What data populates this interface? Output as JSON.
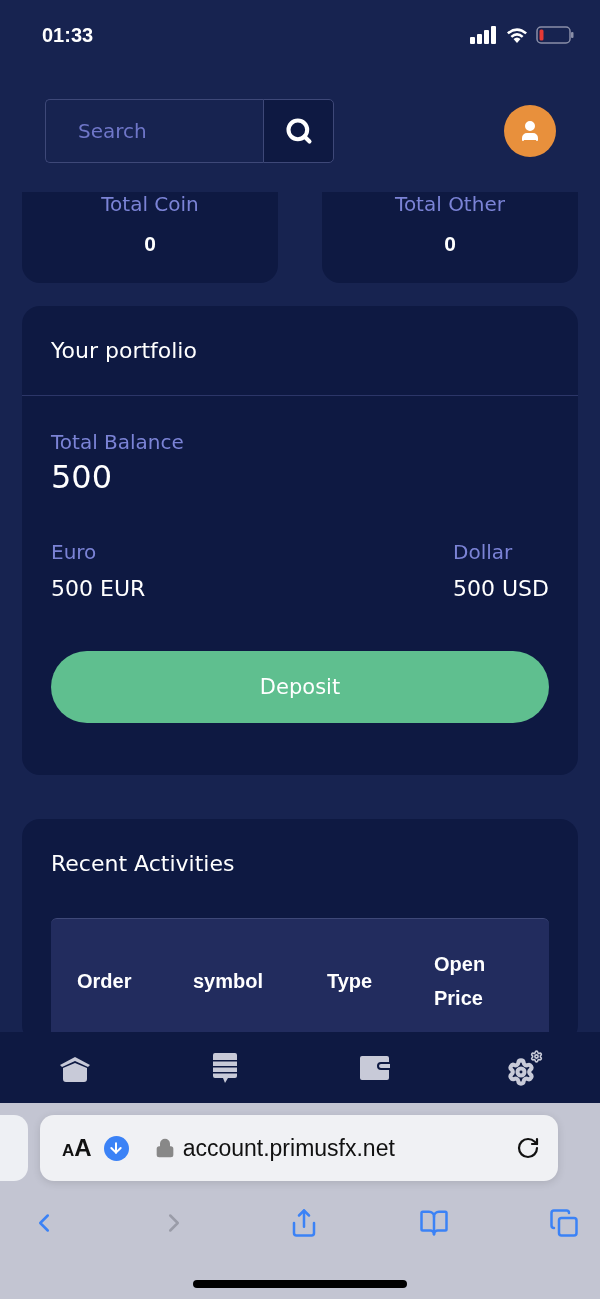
{
  "status_bar": {
    "time": "01:33"
  },
  "header": {
    "search": {
      "placeholder": "Search"
    }
  },
  "stats": [
    {
      "label": "Total Coin",
      "value": "0"
    },
    {
      "label": "Total Other",
      "value": "0"
    }
  ],
  "portfolio": {
    "title": "Your portfolio",
    "balance_label": "Total Balance",
    "balance": "500",
    "currencies": [
      {
        "label": "Euro",
        "value": "500 EUR"
      },
      {
        "label": "Dollar",
        "value": "500 USD"
      }
    ],
    "button": "Deposit"
  },
  "activities": {
    "title": "Recent Activities",
    "columns": [
      "Order",
      "symbol",
      "Type",
      "Open Price"
    ]
  },
  "bottom_nav": [
    {
      "kind": "home"
    },
    {
      "kind": "messages"
    },
    {
      "kind": "wallet"
    },
    {
      "kind": "settings"
    }
  ],
  "browser": {
    "reader_button": "AA",
    "url": "account.primusfx.net",
    "toolbar": [
      {
        "kind": "back",
        "disabled": false
      },
      {
        "kind": "forward",
        "disabled": true
      },
      {
        "kind": "share",
        "disabled": false
      },
      {
        "kind": "bookmarks",
        "disabled": false
      },
      {
        "kind": "tabs",
        "disabled": false
      }
    ]
  }
}
